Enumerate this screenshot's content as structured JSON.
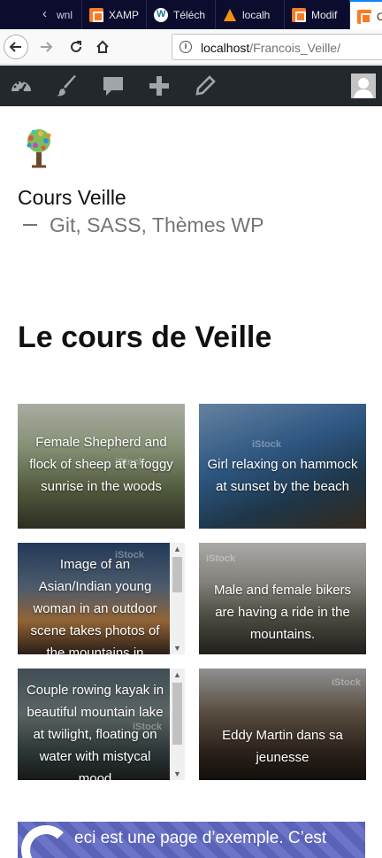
{
  "browser": {
    "tabs": [
      {
        "label": "wnl"
      },
      {
        "label": "XAMP"
      },
      {
        "label": "Téléch"
      },
      {
        "label": "localh"
      },
      {
        "label": "Modif"
      },
      {
        "label": "C"
      }
    ],
    "url": {
      "host": "localhost",
      "path": "/Francois_Veille/"
    }
  },
  "admin_bar": {
    "icons": [
      "dashboard-icon",
      "customize-brush-icon",
      "comments-icon",
      "new-plus-icon",
      "edit-pencil-icon"
    ]
  },
  "site": {
    "title": "Cours Veille",
    "description": "Git, SASS, Thèmes WP"
  },
  "page": {
    "title": "Le cours de Veille"
  },
  "cards": [
    {
      "caption": "Female Shepherd and flock of sheep at a foggy sunrise in the woods",
      "watermark": "iStock"
    },
    {
      "caption": "Girl relaxing on hammock at sunset by the beach",
      "watermark": "iStock"
    },
    {
      "caption": "Image of an Asian/Indian young woman in an outdoor scene takes photos of the mountains in",
      "watermark": "iStock"
    },
    {
      "caption": "Male and female bikers are having a ride in the mountains.",
      "watermark": "iStock"
    },
    {
      "caption": "Couple rowing kayak in beautiful mountain lake at twilight, floating on water with mistycal mood",
      "watermark": "iStock"
    },
    {
      "caption": "Eddy Martin dans sa jeunesse",
      "watermark": "iStock"
    }
  ],
  "banner": {
    "text": "eci est une page d’exemple. C’est"
  },
  "colors": {
    "admin_bar": "#23282d",
    "tab_strip": "#0c0c2e",
    "banner": "#5a63b8"
  }
}
